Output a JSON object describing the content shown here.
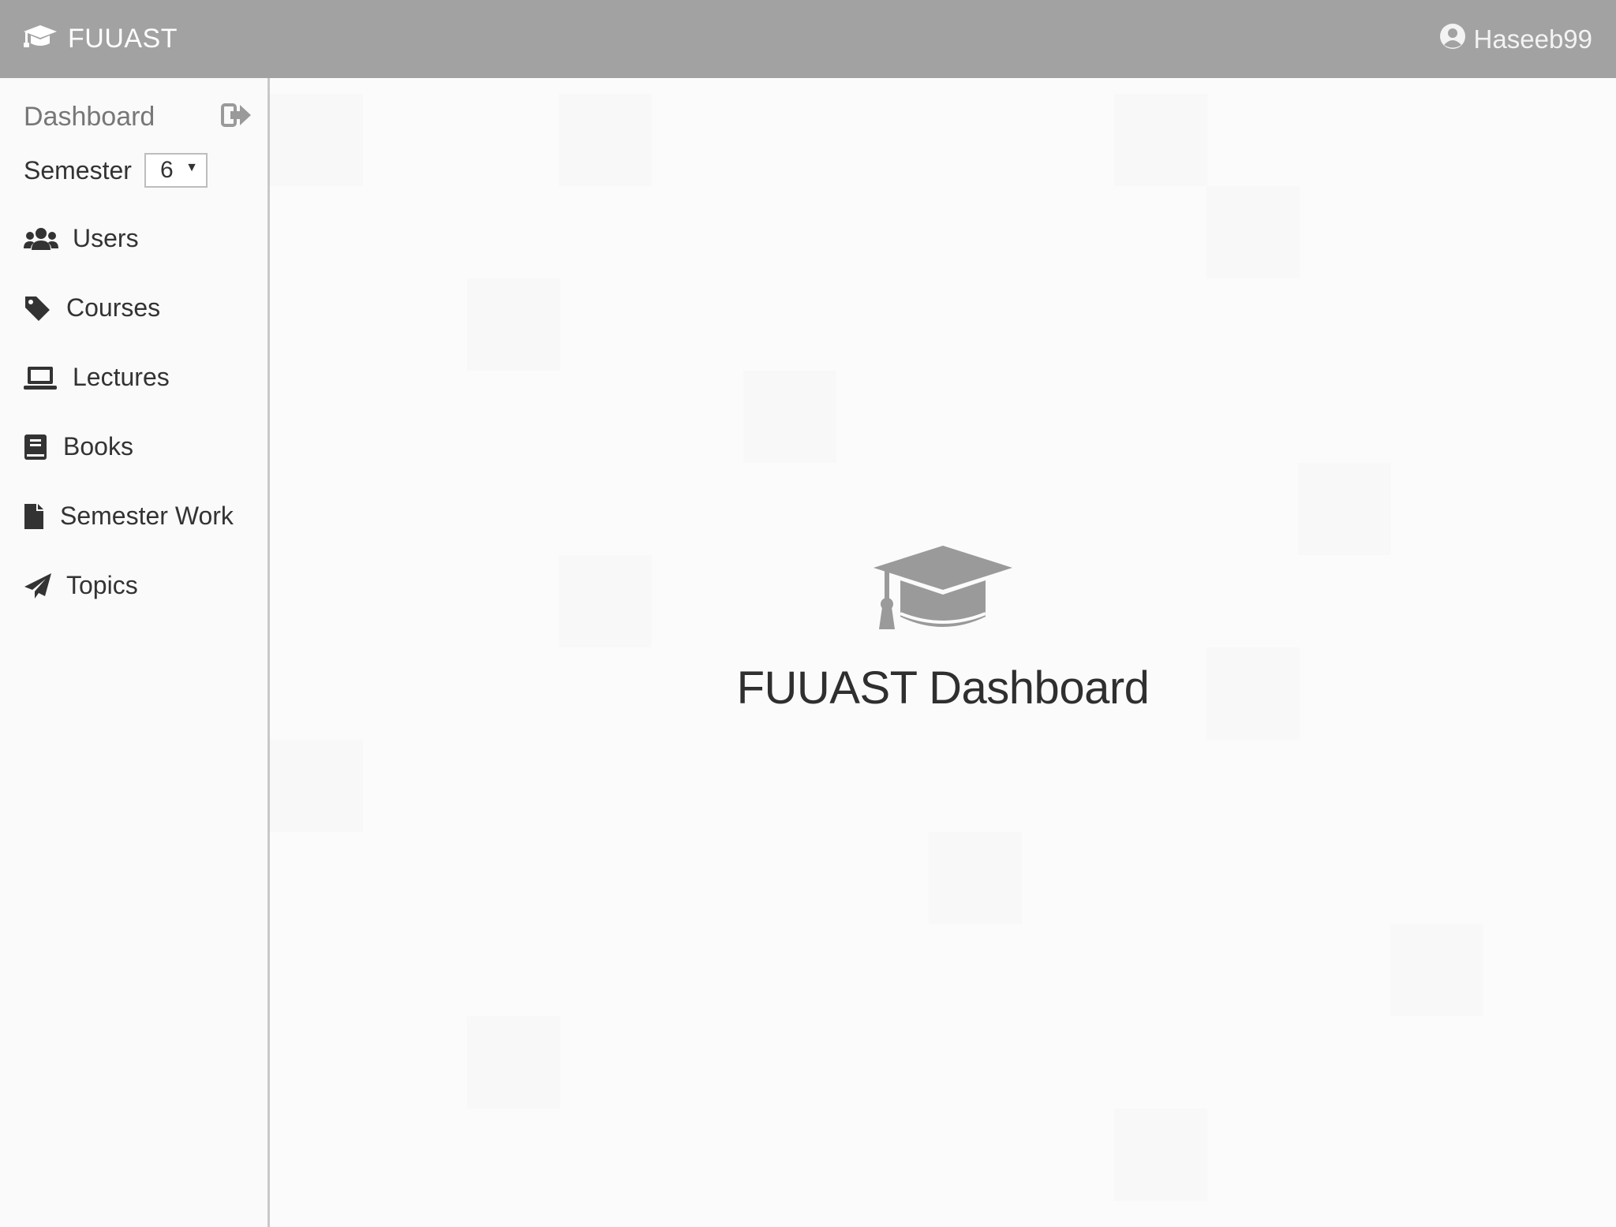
{
  "header": {
    "brand": "FUUAST",
    "username": "Haseeb99"
  },
  "sidebar": {
    "title": "Dashboard",
    "semester_label": "Semester",
    "semester_value": "6",
    "items": [
      {
        "label": "Users",
        "icon": "users-icon"
      },
      {
        "label": "Courses",
        "icon": "tag-icon"
      },
      {
        "label": "Lectures",
        "icon": "laptop-icon"
      },
      {
        "label": "Books",
        "icon": "book-icon"
      },
      {
        "label": "Semester Work",
        "icon": "file-icon"
      },
      {
        "label": "Topics",
        "icon": "paper-plane-icon"
      }
    ]
  },
  "main": {
    "hero_title": "FUUAST Dashboard",
    "hero_icon": "graduation-cap-icon"
  },
  "colors": {
    "topbar": "#a2a2a2",
    "icon_gray": "#9a9a9a",
    "text_dark": "#333333"
  }
}
